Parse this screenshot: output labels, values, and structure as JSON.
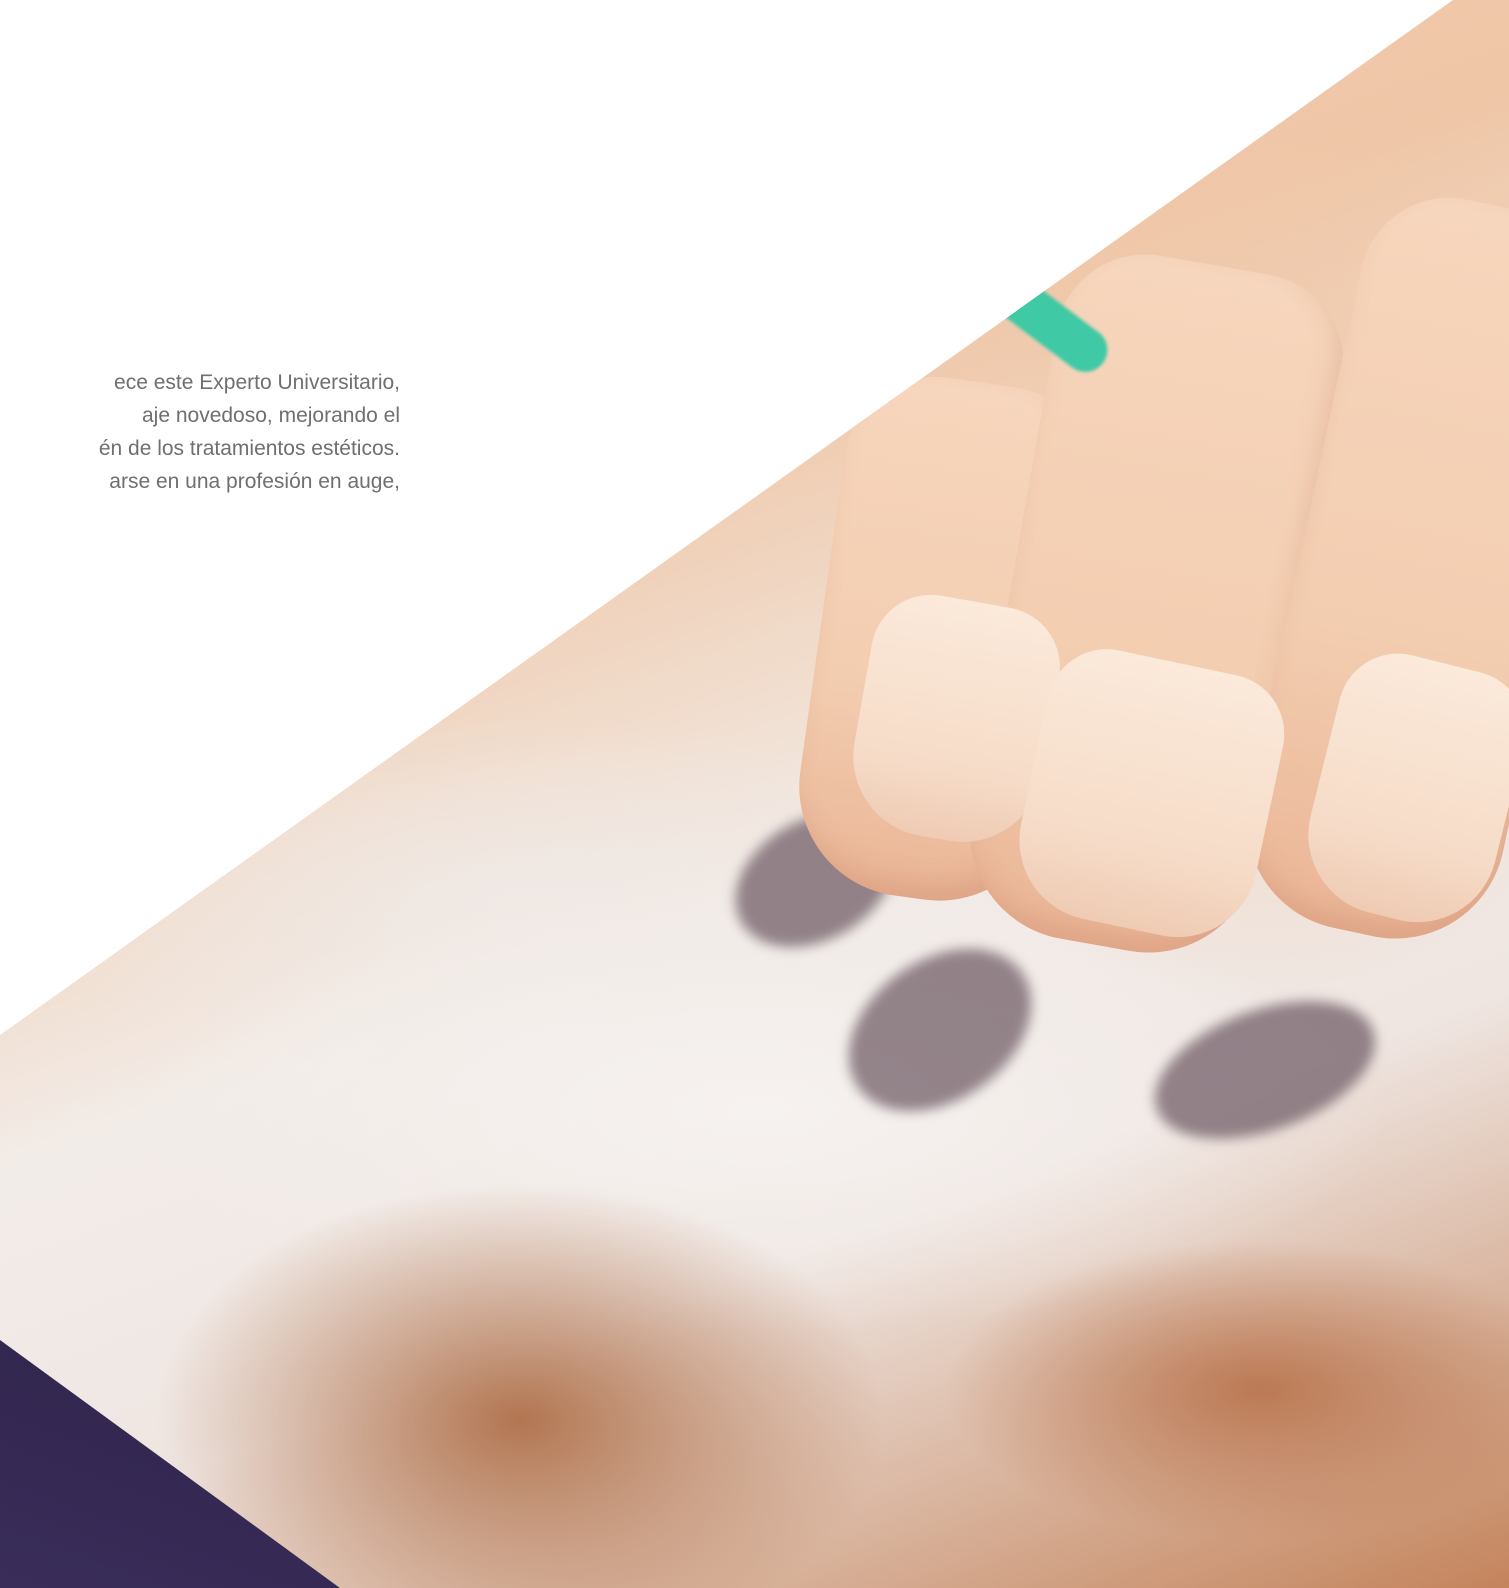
{
  "intro": {
    "lines": [
      "ece este Experto Universitario,",
      "aje novedoso, mejorando el",
      "én de los tratamientos estéticos.",
      "arse en una profesión en auge,"
    ]
  },
  "colors": {
    "text": "#6f6f6f",
    "ring_accent": "#3fc9a4",
    "skin": "#f3cdb0",
    "mask": "#f2ece8",
    "dark_corner": "#2d2048"
  },
  "icons": {
    "hero": "photo-of-facial-mask-treatment"
  }
}
